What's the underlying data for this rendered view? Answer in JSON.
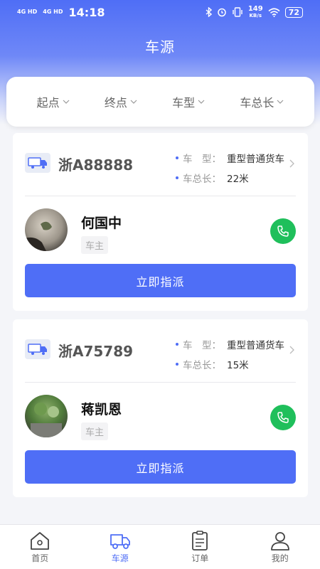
{
  "status_bar": {
    "signal_1": "4G HD",
    "signal_2": "4G HD",
    "time": "14:18",
    "net_speed": "149",
    "net_unit": "KB/s",
    "battery": "72"
  },
  "header": {
    "title": "车源"
  },
  "filters": [
    {
      "label": "起点"
    },
    {
      "label": "终点"
    },
    {
      "label": "车型"
    },
    {
      "label": "车总长"
    }
  ],
  "vehicles": [
    {
      "plate": "浙A88888",
      "type_label": "车　型：",
      "type_value": "重型普通货车",
      "length_label": "车总长：",
      "length_value": "22米",
      "driver_name": "何国中",
      "owner_tag": "车主",
      "assign_label": "立即指派"
    },
    {
      "plate": "浙A75789",
      "type_label": "车　型：",
      "type_value": "重型普通货车",
      "length_label": "车总长：",
      "length_value": "15米",
      "driver_name": "蒋凯恩",
      "owner_tag": "车主",
      "assign_label": "立即指派"
    }
  ],
  "tabbar": [
    {
      "label": "首页",
      "icon": "home-icon",
      "active": false
    },
    {
      "label": "车源",
      "icon": "truck-icon",
      "active": true
    },
    {
      "label": "订单",
      "icon": "clipboard-icon",
      "active": false
    },
    {
      "label": "我的",
      "icon": "user-icon",
      "active": false
    }
  ],
  "colors": {
    "primary": "#4f6ef6",
    "call_green": "#1fbf5b"
  }
}
